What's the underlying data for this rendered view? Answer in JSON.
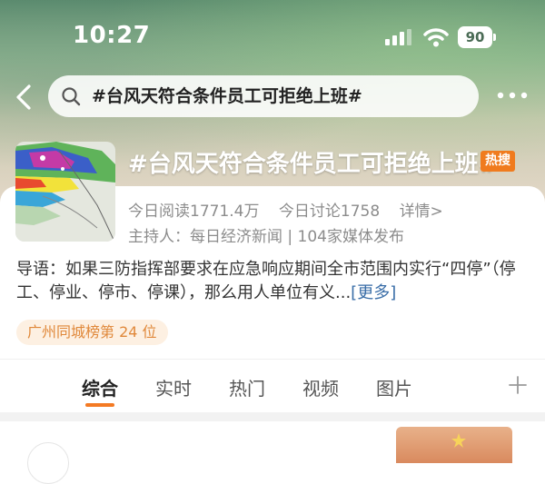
{
  "status_bar": {
    "time": "10:27",
    "battery": "90"
  },
  "nav": {
    "search_text": "#台风天符合条件员工可拒绝上班#"
  },
  "topic": {
    "title": "#台风天符合条件员工可拒绝上班#",
    "hot_badge": "热搜",
    "reads": "今日阅读1771.4万",
    "discussions": "今日讨论1758",
    "details": "详情>",
    "host": "主持人：每日经济新闻 | 104家媒体发布",
    "intro": "导语：如果三防指挥部要求在应急响应期间全市范围内实行“四停”（停工、停业、停市、停课），那么用人单位有义...",
    "more_link": "[更多]",
    "rank": "广州同城榜第 24 位"
  },
  "tabs": [
    {
      "label": "综合",
      "active": true
    },
    {
      "label": "实时",
      "active": false
    },
    {
      "label": "热门",
      "active": false
    },
    {
      "label": "视频",
      "active": false
    },
    {
      "label": "图片",
      "active": false
    }
  ],
  "colors": {
    "accent": "#f47a23",
    "hot_badge": "#f07b1e",
    "link": "#3a6ea8",
    "rank_text": "#e0883a"
  },
  "icons": [
    "chevron-left-icon",
    "search-icon",
    "more-icon",
    "plus-icon",
    "signal-icon",
    "wifi-icon",
    "battery-icon"
  ]
}
